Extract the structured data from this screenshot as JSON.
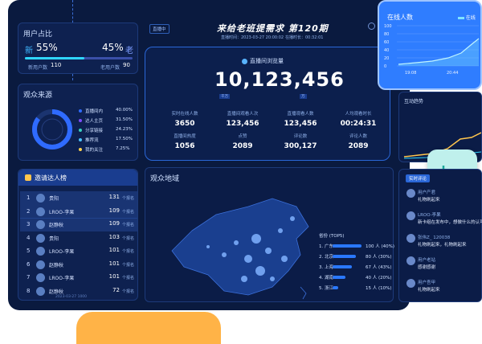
{
  "header": {
    "title": "来给老班提需求 第120期",
    "badge": "直播中",
    "meta_left": "直播时间：2023-03-27 20:00:02",
    "meta_right": "在播时长：00:32:01"
  },
  "user_ratio": {
    "title": "用户占比",
    "new_label": "新",
    "new_pct": "55%",
    "old_pct": "45%",
    "old_label": "老",
    "new_count_label": "新用户数",
    "new_count": "110",
    "old_count_label": "老用户数",
    "old_count": "90",
    "new_fraction": 0.55
  },
  "audience_source": {
    "title": "观众来源",
    "items": [
      {
        "label": "直播间内",
        "value": "40.00%",
        "color": "#2f6bff"
      },
      {
        "label": "达人主页",
        "value": "31.50%",
        "color": "#7d4dff"
      },
      {
        "label": "分享链接",
        "value": "24.23%",
        "color": "#39d1c1"
      },
      {
        "label": "推荐流",
        "value": "17.50%",
        "color": "#4bc2ff"
      },
      {
        "label": "我的关注",
        "value": "7.25%",
        "color": "#ffd24d"
      }
    ]
  },
  "ranking": {
    "title": "邀请达人榜",
    "rows": [
      {
        "rank": "1",
        "name": "贵阳",
        "value": "131",
        "unit": "个报名"
      },
      {
        "rank": "2",
        "name": "LROO-李果",
        "value": "109",
        "unit": "个报名"
      },
      {
        "rank": "3",
        "name": "赵静秋",
        "value": "109",
        "unit": "个报名"
      },
      {
        "rank": "4",
        "name": "贵阳",
        "value": "103",
        "unit": "个报名"
      },
      {
        "rank": "5",
        "name": "LROO-李果",
        "value": "101",
        "unit": "个报名"
      },
      {
        "rank": "6",
        "name": "赵静秋",
        "value": "101",
        "unit": "个报名"
      },
      {
        "rank": "7",
        "name": "LROO-李果",
        "value": "101",
        "unit": "个报名"
      },
      {
        "rank": "8",
        "name": "赵静秋",
        "value": "72",
        "unit": "个报名"
      }
    ],
    "footer": "2023-03-27 1000"
  },
  "views": {
    "label": "直播间浏览量",
    "total": "10,123,456",
    "unit_left": "千万",
    "unit_right": "万",
    "stats": [
      {
        "label": "实时在线人数",
        "value": "3650"
      },
      {
        "label": "直播间观看人次",
        "value": "123,456"
      },
      {
        "label": "直播观看人数",
        "value": "123,456"
      },
      {
        "label": "人均观看时长",
        "value": "00:24:31"
      },
      {
        "label": "直播间热度",
        "value": "1056"
      },
      {
        "label": "点赞",
        "value": "2089"
      },
      {
        "label": "评论数",
        "value": "300,127"
      },
      {
        "label": "评论人数",
        "value": "2089"
      }
    ]
  },
  "map": {
    "title": "观众地域",
    "top_title": "省份 (TOP5)",
    "provinces": [
      {
        "label": "1. 广东",
        "value": "100 人 (40%)",
        "fraction": 1.0
      },
      {
        "label": "2. 北京",
        "value": "80 人 (30%)",
        "fraction": 0.8
      },
      {
        "label": "3. 上海",
        "value": "67 人 (43%)",
        "fraction": 0.67
      },
      {
        "label": "4. 湖南",
        "value": "40 人 (20%)",
        "fraction": 0.45
      },
      {
        "label": "5. 浙江",
        "value": "15 人 (10%)",
        "fraction": 0.2
      }
    ]
  },
  "online_card": {
    "title": "在线人数",
    "legend": "在线",
    "ticks": [
      "100",
      "80",
      "60",
      "40",
      "20",
      "0"
    ],
    "times": [
      "19:08",
      "20:44"
    ]
  },
  "interaction": {
    "title": "互动趋势"
  },
  "comments": {
    "title": "实时评论",
    "items": [
      {
        "user": "用户产君",
        "text": "礼物刷起来"
      },
      {
        "user": "LROO-李果",
        "text": "新卡组在发布中，想做什么的认可"
      },
      {
        "user": "张伟Z_ 120038",
        "text": "礼物刷起来，礼物刷起来"
      },
      {
        "user": "用户老站",
        "text": "感谢感谢"
      },
      {
        "user": "用户吾甲",
        "text": "礼物刷起来"
      }
    ]
  }
}
